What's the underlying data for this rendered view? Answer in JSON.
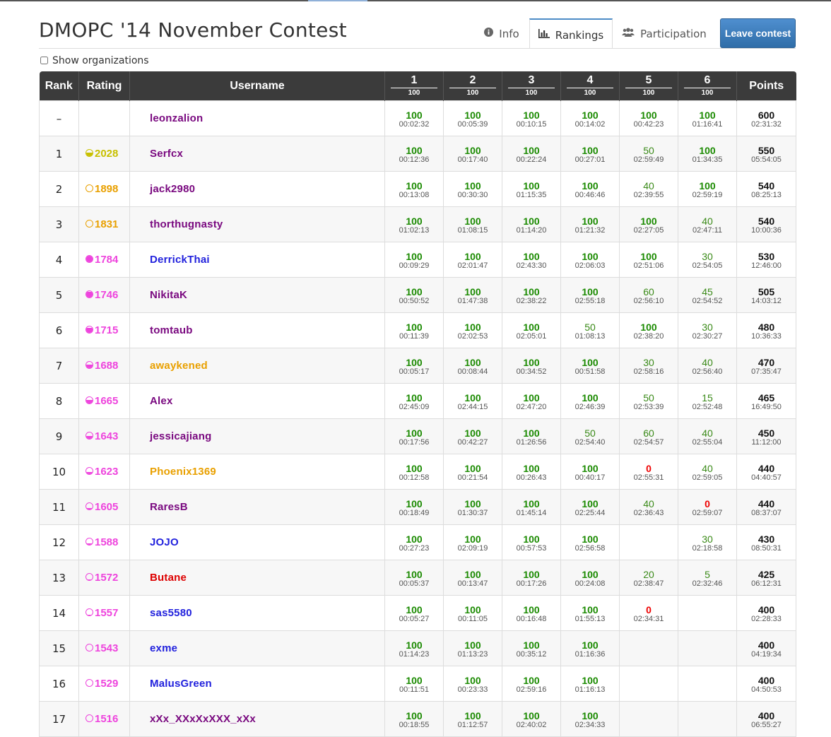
{
  "title": "DMOPC '14 November Contest",
  "tabs": {
    "info": "Info",
    "rankings": "Rankings",
    "participation": "Participation"
  },
  "leave_button": "Leave contest",
  "show_orgs": "Show organizations",
  "headers": {
    "rank": "Rank",
    "rating": "Rating",
    "username": "Username",
    "points": "Points",
    "problems": [
      {
        "num": "1",
        "pts": "100"
      },
      {
        "num": "2",
        "pts": "100"
      },
      {
        "num": "3",
        "pts": "100"
      },
      {
        "num": "4",
        "pts": "100"
      },
      {
        "num": "5",
        "pts": "100"
      },
      {
        "num": "6",
        "pts": "100"
      }
    ]
  },
  "colors": {
    "full_score": "#1a8a00",
    "zero_score": "#e00000",
    "header_bg": "#3b3b3b",
    "user_purple": "#7a0a80",
    "user_blue": "#2222dd",
    "user_orange": "#e9a000",
    "user_red": "#dd0000",
    "rating_yellow": "#c8c000",
    "rating_orange": "#e9a000",
    "rating_pink": "#ee44dd"
  },
  "rows": [
    {
      "rank": "–",
      "rating": "",
      "rating_color": "",
      "rating_fill": 0,
      "user": "leonzalion",
      "user_color": "#7a0a80",
      "problems": [
        [
          "100",
          "00:02:32"
        ],
        [
          "100",
          "00:05:39"
        ],
        [
          "100",
          "00:10:15"
        ],
        [
          "100",
          "00:14:02"
        ],
        [
          "100",
          "00:42:23"
        ],
        [
          "100",
          "01:16:41"
        ]
      ],
      "points": "600",
      "time": "02:31:32"
    },
    {
      "rank": "1",
      "rating": "2028",
      "rating_color": "#c8c000",
      "rating_fill": 0.5,
      "user": "Serfcx",
      "user_color": "#7a0a80",
      "problems": [
        [
          "100",
          "00:12:36"
        ],
        [
          "100",
          "00:17:40"
        ],
        [
          "100",
          "00:22:24"
        ],
        [
          "100",
          "00:27:01"
        ],
        [
          "50",
          "02:59:49"
        ],
        [
          "100",
          "01:34:35"
        ]
      ],
      "points": "550",
      "time": "05:54:05"
    },
    {
      "rank": "2",
      "rating": "1898",
      "rating_color": "#e9a000",
      "rating_fill": 0,
      "user": "jack2980",
      "user_color": "#7a0a80",
      "problems": [
        [
          "100",
          "00:13:08"
        ],
        [
          "100",
          "00:30:30"
        ],
        [
          "100",
          "01:15:35"
        ],
        [
          "100",
          "00:46:46"
        ],
        [
          "40",
          "02:39:55"
        ],
        [
          "100",
          "02:59:19"
        ]
      ],
      "points": "540",
      "time": "08:25:13"
    },
    {
      "rank": "3",
      "rating": "1831",
      "rating_color": "#e9a000",
      "rating_fill": 0,
      "user": "thorthugnasty",
      "user_color": "#7a0a80",
      "problems": [
        [
          "100",
          "01:02:13"
        ],
        [
          "100",
          "01:08:15"
        ],
        [
          "100",
          "01:14:20"
        ],
        [
          "100",
          "01:21:32"
        ],
        [
          "100",
          "02:27:05"
        ],
        [
          "40",
          "02:47:11"
        ]
      ],
      "points": "540",
      "time": "10:00:36"
    },
    {
      "rank": "4",
      "rating": "1784",
      "rating_color": "#ee44dd",
      "rating_fill": 1,
      "user": "DerrickThai",
      "user_color": "#2222dd",
      "problems": [
        [
          "100",
          "00:09:29"
        ],
        [
          "100",
          "02:01:47"
        ],
        [
          "100",
          "02:43:30"
        ],
        [
          "100",
          "02:06:03"
        ],
        [
          "100",
          "02:51:06"
        ],
        [
          "30",
          "02:54:05"
        ]
      ],
      "points": "530",
      "time": "12:46:00"
    },
    {
      "rank": "5",
      "rating": "1746",
      "rating_color": "#ee44dd",
      "rating_fill": 0.85,
      "user": "NikitaK",
      "user_color": "#7a0a80",
      "problems": [
        [
          "100",
          "00:50:52"
        ],
        [
          "100",
          "01:47:38"
        ],
        [
          "100",
          "02:38:22"
        ],
        [
          "100",
          "02:55:18"
        ],
        [
          "60",
          "02:56:10"
        ],
        [
          "45",
          "02:54:52"
        ]
      ],
      "points": "505",
      "time": "14:03:12"
    },
    {
      "rank": "6",
      "rating": "1715",
      "rating_color": "#ee44dd",
      "rating_fill": 0.7,
      "user": "tomtaub",
      "user_color": "#7a0a80",
      "problems": [
        [
          "100",
          "00:11:39"
        ],
        [
          "100",
          "02:02:53"
        ],
        [
          "100",
          "02:05:01"
        ],
        [
          "50",
          "01:08:13"
        ],
        [
          "100",
          "02:38:20"
        ],
        [
          "30",
          "02:30:27"
        ]
      ],
      "points": "480",
      "time": "10:36:33"
    },
    {
      "rank": "7",
      "rating": "1688",
      "rating_color": "#ee44dd",
      "rating_fill": 0.55,
      "user": "awaykened",
      "user_color": "#e9a000",
      "problems": [
        [
          "100",
          "00:05:17"
        ],
        [
          "100",
          "00:08:44"
        ],
        [
          "100",
          "00:34:52"
        ],
        [
          "100",
          "00:51:58"
        ],
        [
          "30",
          "02:58:16"
        ],
        [
          "40",
          "02:56:40"
        ]
      ],
      "points": "470",
      "time": "07:35:47"
    },
    {
      "rank": "8",
      "rating": "1665",
      "rating_color": "#ee44dd",
      "rating_fill": 0.45,
      "user": "Alex",
      "user_color": "#7a0a80",
      "problems": [
        [
          "100",
          "02:45:09"
        ],
        [
          "100",
          "02:44:15"
        ],
        [
          "100",
          "02:47:20"
        ],
        [
          "100",
          "02:46:39"
        ],
        [
          "50",
          "02:53:39"
        ],
        [
          "15",
          "02:52:48"
        ]
      ],
      "points": "465",
      "time": "16:49:50"
    },
    {
      "rank": "9",
      "rating": "1643",
      "rating_color": "#ee44dd",
      "rating_fill": 0.38,
      "user": "jessicajiang",
      "user_color": "#7a0a80",
      "problems": [
        [
          "100",
          "00:17:56"
        ],
        [
          "100",
          "00:42:27"
        ],
        [
          "100",
          "01:26:56"
        ],
        [
          "50",
          "02:54:40"
        ],
        [
          "60",
          "02:54:57"
        ],
        [
          "40",
          "02:55:04"
        ]
      ],
      "points": "450",
      "time": "11:12:00"
    },
    {
      "rank": "10",
      "rating": "1623",
      "rating_color": "#ee44dd",
      "rating_fill": 0.3,
      "user": "Phoenix1369",
      "user_color": "#e9a000",
      "problems": [
        [
          "100",
          "00:12:58"
        ],
        [
          "100",
          "00:21:54"
        ],
        [
          "100",
          "00:26:43"
        ],
        [
          "100",
          "00:40:17"
        ],
        [
          "0",
          "02:55:31"
        ],
        [
          "40",
          "02:59:05"
        ]
      ],
      "points": "440",
      "time": "04:40:57"
    },
    {
      "rank": "11",
      "rating": "1605",
      "rating_color": "#ee44dd",
      "rating_fill": 0.22,
      "user": "RaresB",
      "user_color": "#7a0a80",
      "problems": [
        [
          "100",
          "00:18:49"
        ],
        [
          "100",
          "01:30:37"
        ],
        [
          "100",
          "01:45:14"
        ],
        [
          "100",
          "02:25:44"
        ],
        [
          "40",
          "02:36:43"
        ],
        [
          "0",
          "02:59:07"
        ]
      ],
      "points": "440",
      "time": "08:37:07"
    },
    {
      "rank": "12",
      "rating": "1588",
      "rating_color": "#ee44dd",
      "rating_fill": 0.15,
      "user": "JOJO",
      "user_color": "#2222dd",
      "problems": [
        [
          "100",
          "00:27:23"
        ],
        [
          "100",
          "02:09:19"
        ],
        [
          "100",
          "00:57:53"
        ],
        [
          "100",
          "02:56:58"
        ],
        [
          "",
          ""
        ],
        [
          "30",
          "02:18:58"
        ]
      ],
      "points": "430",
      "time": "08:50:31"
    },
    {
      "rank": "13",
      "rating": "1572",
      "rating_color": "#ee44dd",
      "rating_fill": 0.08,
      "user": "Butane",
      "user_color": "#dd0000",
      "problems": [
        [
          "100",
          "00:05:37"
        ],
        [
          "100",
          "00:13:47"
        ],
        [
          "100",
          "00:17:26"
        ],
        [
          "100",
          "00:24:08"
        ],
        [
          "20",
          "02:38:47"
        ],
        [
          "5",
          "02:32:46"
        ]
      ],
      "points": "425",
      "time": "06:12:31"
    },
    {
      "rank": "14",
      "rating": "1557",
      "rating_color": "#ee44dd",
      "rating_fill": 0.05,
      "user": "sas5580",
      "user_color": "#2222dd",
      "problems": [
        [
          "100",
          "00:05:27"
        ],
        [
          "100",
          "00:11:05"
        ],
        [
          "100",
          "00:16:48"
        ],
        [
          "100",
          "01:55:13"
        ],
        [
          "0",
          "02:34:31"
        ],
        [
          "",
          ""
        ]
      ],
      "points": "400",
      "time": "02:28:33"
    },
    {
      "rank": "15",
      "rating": "1543",
      "rating_color": "#ee44dd",
      "rating_fill": 0,
      "user": "exme",
      "user_color": "#2222dd",
      "problems": [
        [
          "100",
          "01:14:23"
        ],
        [
          "100",
          "01:13:23"
        ],
        [
          "100",
          "00:35:12"
        ],
        [
          "100",
          "01:16:36"
        ],
        [
          "",
          ""
        ],
        [
          "",
          ""
        ]
      ],
      "points": "400",
      "time": "04:19:34"
    },
    {
      "rank": "16",
      "rating": "1529",
      "rating_color": "#ee44dd",
      "rating_fill": 0,
      "user": "MalusGreen",
      "user_color": "#2222dd",
      "problems": [
        [
          "100",
          "00:11:51"
        ],
        [
          "100",
          "00:23:33"
        ],
        [
          "100",
          "02:59:16"
        ],
        [
          "100",
          "01:16:13"
        ],
        [
          "",
          ""
        ],
        [
          "",
          ""
        ]
      ],
      "points": "400",
      "time": "04:50:53"
    },
    {
      "rank": "17",
      "rating": "1516",
      "rating_color": "#ee44dd",
      "rating_fill": 0,
      "user": "xXx_XXxXxXXX_xXx",
      "user_color": "#7a0a80",
      "problems": [
        [
          "100",
          "00:18:55"
        ],
        [
          "100",
          "01:12:57"
        ],
        [
          "100",
          "02:40:02"
        ],
        [
          "100",
          "02:34:33"
        ],
        [
          "",
          ""
        ],
        [
          "",
          ""
        ]
      ],
      "points": "400",
      "time": "06:55:27"
    }
  ]
}
